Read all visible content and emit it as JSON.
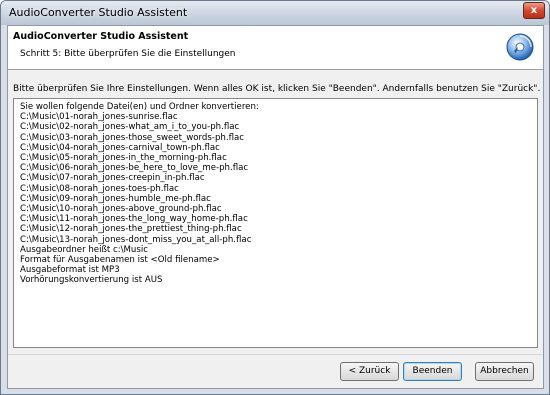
{
  "window": {
    "title": "AudioConverter Studio Assistent",
    "close_glyph": "x"
  },
  "header": {
    "title": "AudioConverter Studio Assistent",
    "subtitle": "Schritt 5: Bitte überprüfen Sie die Einstellungen",
    "icon": "audioconverter-logo-icon"
  },
  "instruction": "Bitte überprüfen Sie Ihre Einstellungen. Wenn alles OK ist, klicken Sie \"Beenden\". Andernfalls benutzen Sie \"Zurück\".",
  "summary": {
    "lines": [
      "Sie wollen folgende Datei(en) und Ordner konvertieren:",
      "C:\\Music\\01-norah_jones-sunrise.flac",
      "C:\\Music\\02-norah_jones-what_am_i_to_you-ph.flac",
      "C:\\Music\\03-norah_jones-those_sweet_words-ph.flac",
      "C:\\Music\\04-norah_jones-carnival_town-ph.flac",
      "C:\\Music\\05-norah_jones-in_the_morning-ph.flac",
      "C:\\Music\\06-norah_jones-be_here_to_love_me-ph.flac",
      "C:\\Music\\07-norah_jones-creepin_in-ph.flac",
      "C:\\Music\\08-norah_jones-toes-ph.flac",
      "C:\\Music\\09-norah_jones-humble_me-ph.flac",
      "C:\\Music\\10-norah_jones-above_ground-ph.flac",
      "C:\\Music\\11-norah_jones-the_long_way_home-ph.flac",
      "C:\\Music\\12-norah_jones-the_prettiest_thing-ph.flac",
      "C:\\Music\\13-norah_jones-dont_miss_you_at_all-ph.flac",
      "Ausgabeordner heißt c:\\Music",
      "Format für Ausgabenamen ist <Old filename>",
      "Ausgabeformat ist MP3",
      "Vorhörungskonvertierung ist AUS"
    ]
  },
  "buttons": {
    "back": "< Zurück",
    "finish": "Beenden",
    "cancel": "Abbrechen"
  },
  "colors": {
    "close_button": "#d2492f",
    "default_button_border": "#3c7fb1",
    "icon_blue": "#2a6fc9"
  }
}
